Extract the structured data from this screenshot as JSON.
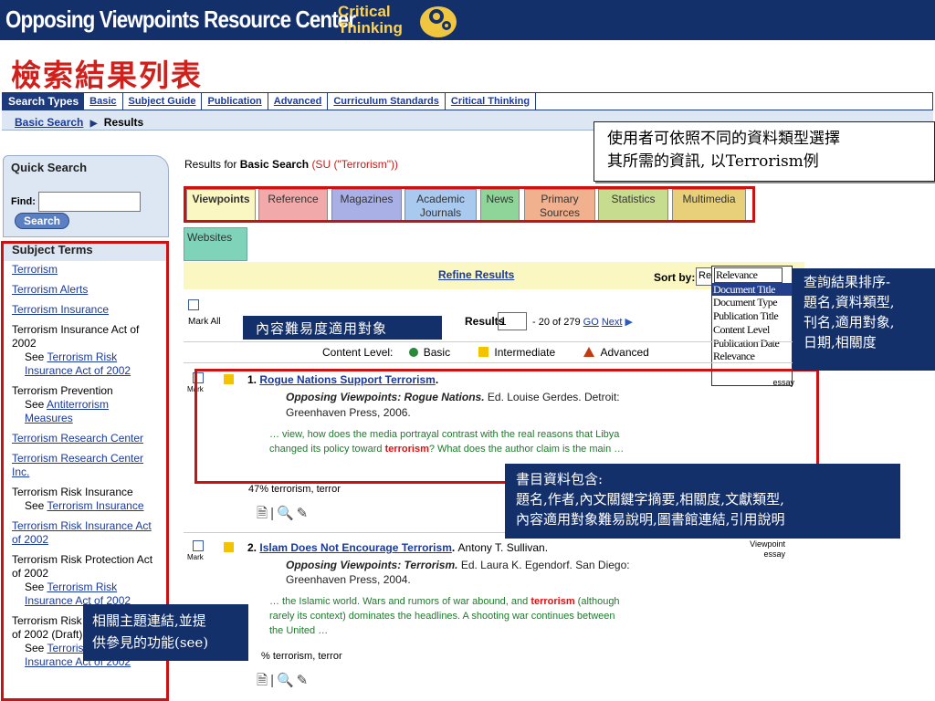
{
  "banner": {
    "title": "Opposing Viewpoints Resource Center",
    "sub_line1": "Critical",
    "sub_line2": "Thinking"
  },
  "page_title": "檢索結果列表",
  "nav": {
    "types_label": "Search Types",
    "links": [
      "Basic",
      "Subject Guide",
      "Publication",
      "Advanced",
      "Curriculum Standards",
      "Critical Thinking"
    ]
  },
  "breadcrumb": {
    "link": "Basic Search",
    "sep": "▶",
    "current": "Results"
  },
  "quick_search": {
    "heading": "Quick Search",
    "find_label": "Find:",
    "find_value": "",
    "button": "Search"
  },
  "subject_terms": {
    "heading": "Subject Terms",
    "items": [
      {
        "type": "link",
        "text": "Terrorism"
      },
      {
        "type": "link",
        "text": "Terrorism Alerts"
      },
      {
        "type": "link",
        "text": "Terrorism Insurance"
      },
      {
        "type": "text",
        "text": "Terrorism Insurance Act of 2002",
        "see": "Terrorism Risk Insurance Act of 2002"
      },
      {
        "type": "text",
        "text": "Terrorism Prevention",
        "see": "Antiterrorism Measures"
      },
      {
        "type": "link",
        "text": "Terrorism Research Center"
      },
      {
        "type": "link",
        "text": "Terrorism Research Center Inc."
      },
      {
        "type": "text",
        "text": "Terrorism Risk Insurance",
        "see": "Terrorism Insurance"
      },
      {
        "type": "link",
        "text": "Terrorism Risk Insurance Act of 2002"
      },
      {
        "type": "text",
        "text": "Terrorism Risk Protection Act of 2002",
        "see": "Terrorism Risk Insurance Act of 2002"
      },
      {
        "type": "text",
        "text": "Terrorism Risk Protection Act of 2002 (Draft)",
        "see": "Terrorism Risk Insurance Act of 2002"
      }
    ],
    "see_prefix": "See"
  },
  "results_for": {
    "prefix": "Results for",
    "type": "Basic Search",
    "query": "(SU (\"Terrorism\"))"
  },
  "tabs": [
    {
      "label": "Viewpoints",
      "color": "#fbf7c2"
    },
    {
      "label": "Reference",
      "color": "#f2a9a9"
    },
    {
      "label": "Magazines",
      "color": "#a8b0e6"
    },
    {
      "label": "Academic Journals",
      "color": "#a9c9ee"
    },
    {
      "label": "News",
      "color": "#8fd59a"
    },
    {
      "label": "Primary Sources",
      "color": "#f1b18f"
    },
    {
      "label": "Statistics",
      "color": "#c7dc8e"
    },
    {
      "label": "Multimedia",
      "color": "#e8d07a"
    },
    {
      "label": "Websites",
      "color": "#7fd3b9"
    }
  ],
  "refine": {
    "link": "Refine Results",
    "sort_label": "Sort by:",
    "sort_value": "Re"
  },
  "sort_options": [
    "Relevance",
    "Document Title",
    "Document Type",
    "Publication Title",
    "Content Level",
    "Publication Date",
    "Relevance"
  ],
  "mark_all": "Mark All",
  "pager": {
    "label": "Results",
    "value": "1",
    "range": "- 20 of 279",
    "go": "GO",
    "next": "Next"
  },
  "content_level": {
    "label": "Content Level:",
    "basic": "Basic",
    "intermediate": "Intermediate",
    "advanced": "Advanced"
  },
  "results": [
    {
      "num": "1.",
      "title": "Rogue Nations Support Terrorism",
      "source": "Opposing Viewpoints: Rogue Nations.",
      "editor": "Ed. Louise Gerdes. Detroit:",
      "publisher": "Greenhaven Press, 2006.",
      "excerpt_a": "… view, how does the media portrayal contrast with the real reasons that Libya changed its policy toward ",
      "excerpt_hit": "terrorism",
      "excerpt_b": "? What does the author claim is the main …",
      "relevance": "47% terrorism, terror",
      "doctype": "essay"
    },
    {
      "num": "2.",
      "title": "Islam Does Not Encourage Terrorism",
      "author": "Antony T. Sullivan.",
      "source": "Opposing Viewpoints: Terrorism.",
      "editor": "Ed. Laura K. Egendorf. San Diego:",
      "publisher": "Greenhaven Press, 2004.",
      "excerpt_a": "… the Islamic world. Wars and rumors of war abound, and ",
      "excerpt_hit": "terrorism",
      "excerpt_b": " (although rarely its context) dominates the headlines. A shooting war continues between the United …",
      "relevance": "% terrorism, terror",
      "doctype_1": "Viewpoint",
      "doctype": "essay"
    }
  ],
  "mark_small": "Mark",
  "callouts": {
    "c1_l1": "使用者可依照不同的資料類型選擇",
    "c1_l2": "其所需的資訊, 以Terrorism例",
    "c2": "內容難易度適用對象",
    "c3_l1": "查詢結果排序-",
    "c3_l2": "題名,資料類型,",
    "c3_l3": "刊名,適用對象,",
    "c3_l4": "日期,相關度",
    "c4_l1": "書目資料包含:",
    "c4_l2": "題名,作者,內文關鍵字摘要,相關度,文獻類型,",
    "c4_l3": "內容適用對象難易說明,圖書館連結,引用說明",
    "c5_l1": "相關主題連結,並提",
    "c5_l2": "供參見的功能(see)"
  },
  "icons": [
    "document-icon",
    "search-magnifier-icon",
    "citation-icon"
  ]
}
